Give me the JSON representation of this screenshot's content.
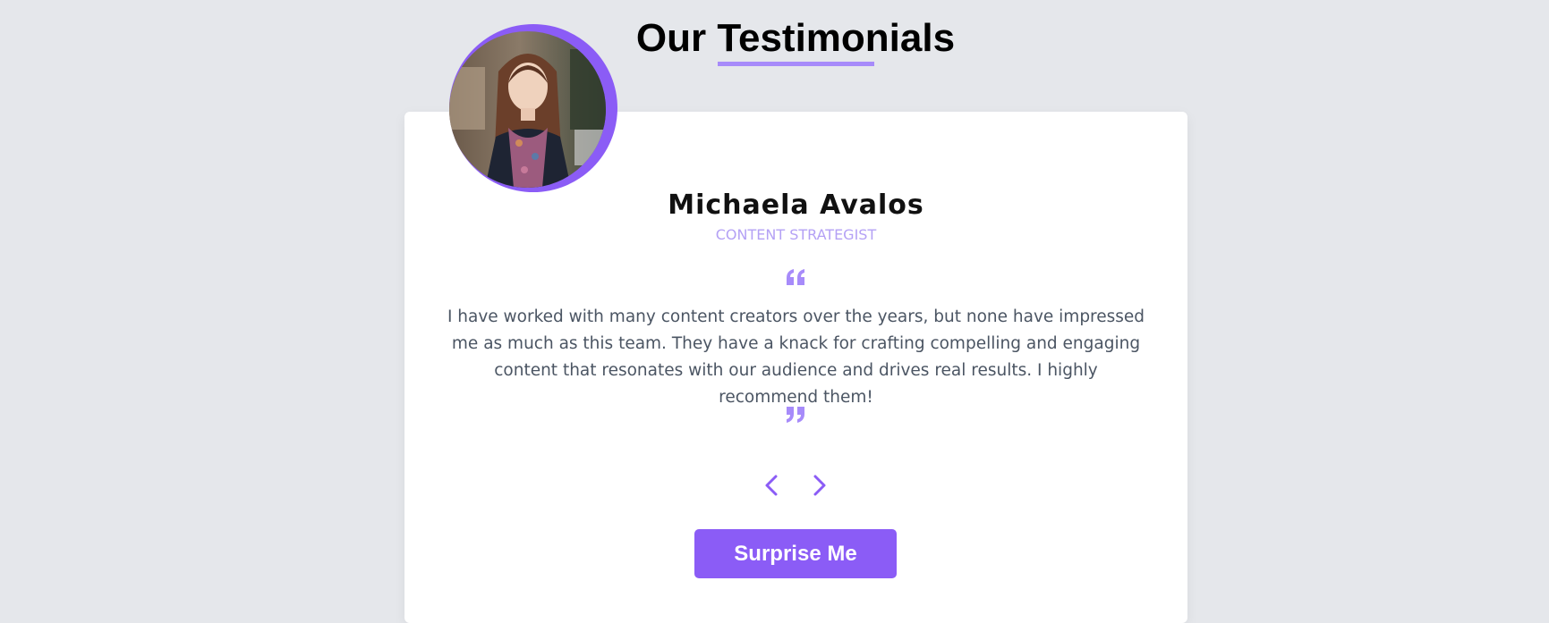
{
  "header": {
    "title": "Our Testimonials",
    "accent_color": "#a78bfa"
  },
  "testimonial": {
    "avatar_icon": "person-photo",
    "name": "Michaela Avalos",
    "role": "CONTENT STRATEGIST",
    "quote": "I have worked with many content creators over the years, but none have impressed me as much as this team. They have a knack for crafting compelling and engaging content that resonates with our audience and drives real results. I highly recommend them!",
    "open_quote_icon": "quote-open-icon",
    "close_quote_icon": "quote-close-icon"
  },
  "navigation": {
    "prev_icon": "chevron-left-icon",
    "next_icon": "chevron-right-icon"
  },
  "actions": {
    "surprise_label": "Surprise Me"
  },
  "colors": {
    "background": "#e5e7eb",
    "card": "#ffffff",
    "primary": "#8b5cf6",
    "role_text": "#b4a1f5",
    "body_text": "#4b5563"
  }
}
